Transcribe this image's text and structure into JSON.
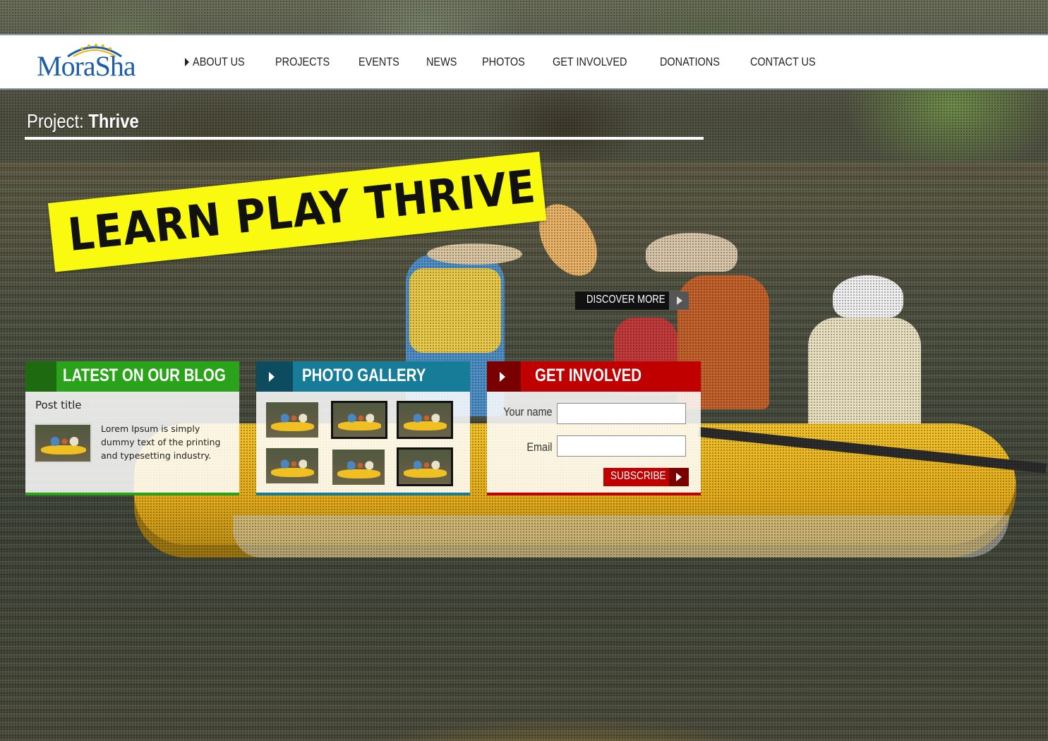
{
  "brand": {
    "logo_text": "MoraSha",
    "logo_color": "#1d5ea8"
  },
  "nav": {
    "items": [
      {
        "label": "ABOUT US",
        "active": true
      },
      {
        "label": "PROJECTS"
      },
      {
        "label": "EVENTS"
      },
      {
        "label": "NEWS"
      },
      {
        "label": "PHOTOS"
      },
      {
        "label": "GET INVOLVED"
      },
      {
        "label": "DONATIONS"
      },
      {
        "label": "CONTACT US"
      }
    ]
  },
  "project": {
    "prefix": "Project:",
    "name": "Thrive"
  },
  "banner": {
    "text": "LEARN PLAY THRIVE",
    "color": "#fafa10"
  },
  "hero": {
    "cta_label": "DISCOVER MORE"
  },
  "blog": {
    "title": "LATEST ON OUR BLOG",
    "accent": "#2aa21a",
    "post_title": "Post title",
    "excerpt": "Lorem Ipsum is simply dummy text of the printing and typesetting industry."
  },
  "gallery": {
    "title": "PHOTO GALLERY",
    "accent": "#177c98"
  },
  "involve": {
    "title": "GET INVOLVED",
    "accent": "#c00000",
    "name_label": "Your name",
    "name_value": "",
    "email_label": "Email",
    "email_value": "",
    "subscribe_label": "SUBSCRIBE"
  }
}
